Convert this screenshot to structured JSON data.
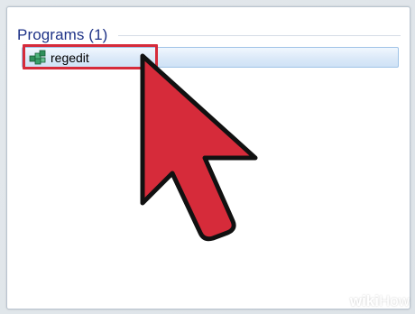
{
  "results": {
    "section_title": "Programs (1)",
    "items": [
      {
        "label": "regedit",
        "icon": "registry-editor-icon"
      }
    ]
  },
  "cursor": {
    "icon": "arrow-cursor-icon",
    "color": "#d62b3a"
  },
  "watermark": {
    "part1": "wiki",
    "part2": "How"
  },
  "colors": {
    "title": "#1e3287",
    "selection_border": "#9fc3e7",
    "highlight": "#d62b3a"
  }
}
